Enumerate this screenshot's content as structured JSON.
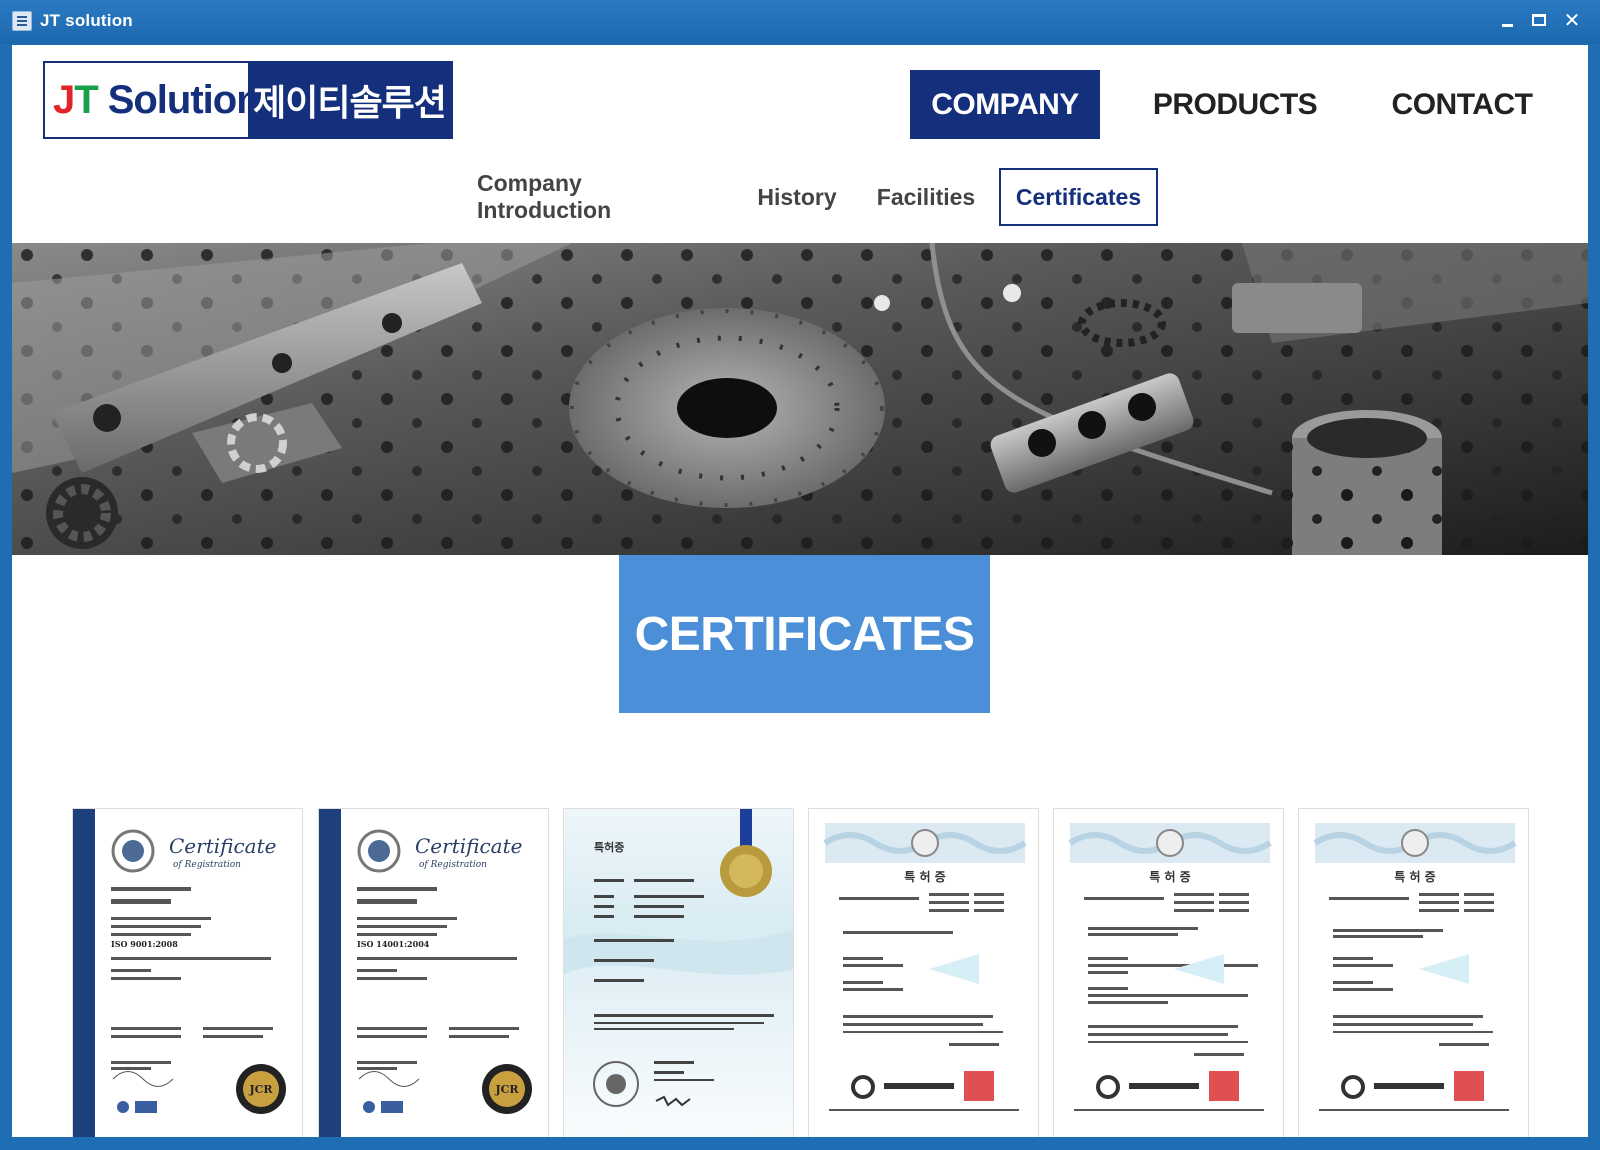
{
  "window": {
    "title": "JT solution",
    "controls": {
      "minimize": "minimize",
      "maximize": "maximize",
      "close": "✕"
    }
  },
  "header": {
    "logo": {
      "j": "J",
      "t": "T",
      "solution": "Solution",
      "korean": "제이티솔루션"
    },
    "main_nav": [
      {
        "label": "COMPANY",
        "active": true
      },
      {
        "label": "PRODUCTS",
        "active": false
      },
      {
        "label": "CONTACT",
        "active": false
      }
    ],
    "sub_nav": [
      {
        "label": "Company Introduction",
        "active": false
      },
      {
        "label": "History",
        "active": false
      },
      {
        "label": "Facilities",
        "active": false
      },
      {
        "label": "Certificates",
        "active": true
      }
    ]
  },
  "page": {
    "section_title": "CERTIFICATES"
  },
  "certificates": [
    {
      "type": "registration",
      "heading": "Certificate",
      "subheading": "of Registration",
      "standard": "ISO 9001:2008",
      "seal": "JCR"
    },
    {
      "type": "registration",
      "heading": "Certificate",
      "subheading": "of Registration",
      "standard": "ISO 14001:2004",
      "seal": "JCR"
    },
    {
      "type": "patent",
      "heading": "특허증"
    },
    {
      "type": "patent",
      "heading": "특 허 증"
    },
    {
      "type": "patent",
      "heading": "특 허 증"
    },
    {
      "type": "patent",
      "heading": "특 허 증"
    }
  ],
  "colors": {
    "titlebar": "#1f6db3",
    "brand_navy": "#14307c",
    "section_blue": "#4a8fd7",
    "logo_red": "#e0242a",
    "logo_green": "#18a04b"
  }
}
